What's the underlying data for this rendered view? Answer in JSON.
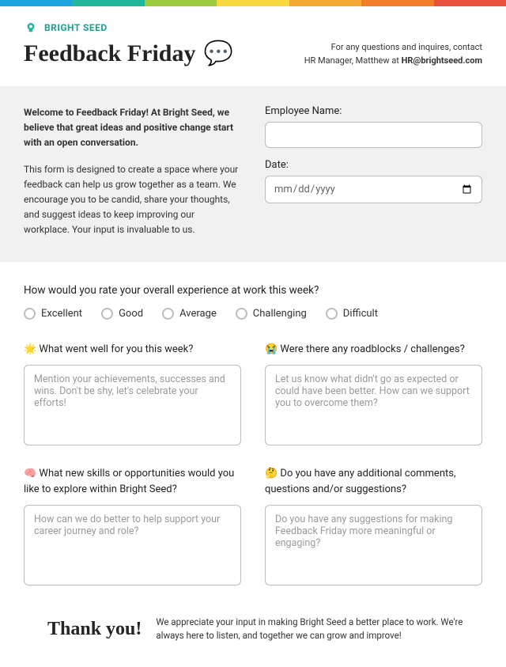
{
  "colors": [
    "#1ea4e0",
    "#1fb89a",
    "#9dcd3f",
    "#f7d93f",
    "#f5a933",
    "#f07e28",
    "#e8513d"
  ],
  "brand": {
    "name": "BRIGHT SEED"
  },
  "header": {
    "title": "Feedback Friday",
    "title_emoji": "💬",
    "contact_line1": "For any questions and inquires, contact",
    "contact_line2_prefix": "HR Manager, Matthew at ",
    "contact_email": "HR@brightseed.com"
  },
  "welcome": {
    "bold": "Welcome to Feedback Friday! At Bright Seed, we believe that great ideas and positive change start with an open conversation.",
    "body": "This form is designed to create a space where your feedback can help us grow together as a team. We encourage you to be candid, share your thoughts, and suggest ideas to keep improving our workplace. Your input is invaluable to us."
  },
  "fields": {
    "name_label": "Employee Name:",
    "date_label": "Date:",
    "date_placeholder": "mm/dd/yyyy"
  },
  "rating": {
    "question": "How would you rate your overall experience at work this week?",
    "options": [
      "Excellent",
      "Good",
      "Average",
      "Challenging",
      "Difficult"
    ]
  },
  "questions": [
    {
      "emoji": "🌟",
      "label": "What went well for you this week?",
      "placeholder": "Mention your achievements, successes and wins. Don't be shy, let's celebrate your efforts!"
    },
    {
      "emoji": "😭",
      "label": "Were there any roadblocks / challenges?",
      "placeholder": "Let us know what didn't go as expected or could have been better. How can we support you to overcome them?"
    },
    {
      "emoji": "🧠",
      "label": "What new skills or opportunities would you like to explore within Bright Seed?",
      "placeholder": "How can we do better to help support your career journey and role?"
    },
    {
      "emoji": "🤔",
      "label": "Do you have any additional comments, questions and/or suggestions?",
      "placeholder": "Do you have any suggestions for making Feedback Friday more meaningful or engaging?"
    }
  ],
  "footer": {
    "thank": "Thank you!",
    "text": "We appreciate your input in making Bright Seed a better place to work. We're always here to listen, and together we can grow and improve!"
  }
}
